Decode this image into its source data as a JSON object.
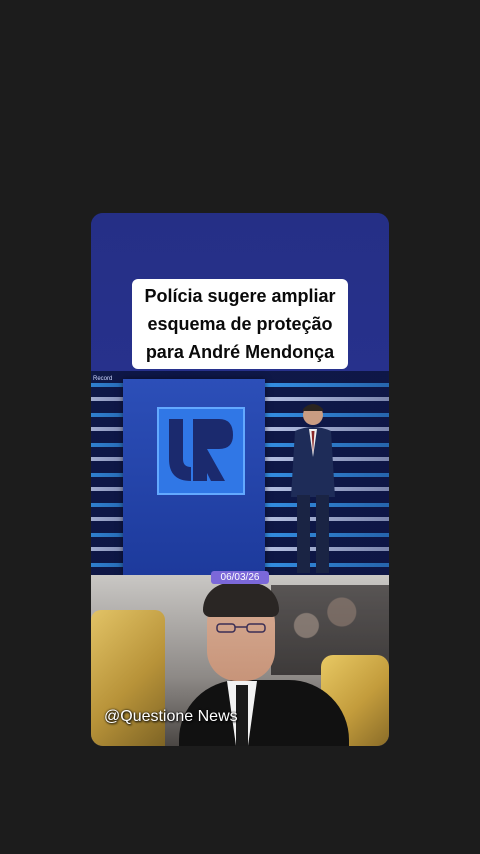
{
  "video": {
    "headline": "Polícia sugere ampliar\nesquema de proteção\npara André Mendonça",
    "date_badge": "06/03/26",
    "watermark": "@Questione News",
    "channel_tag": "Record"
  },
  "colors": {
    "background": "#1c1c1c",
    "studio_blue": "#252f86",
    "badge": "#7b68d9",
    "title_box": "#ffffff"
  }
}
